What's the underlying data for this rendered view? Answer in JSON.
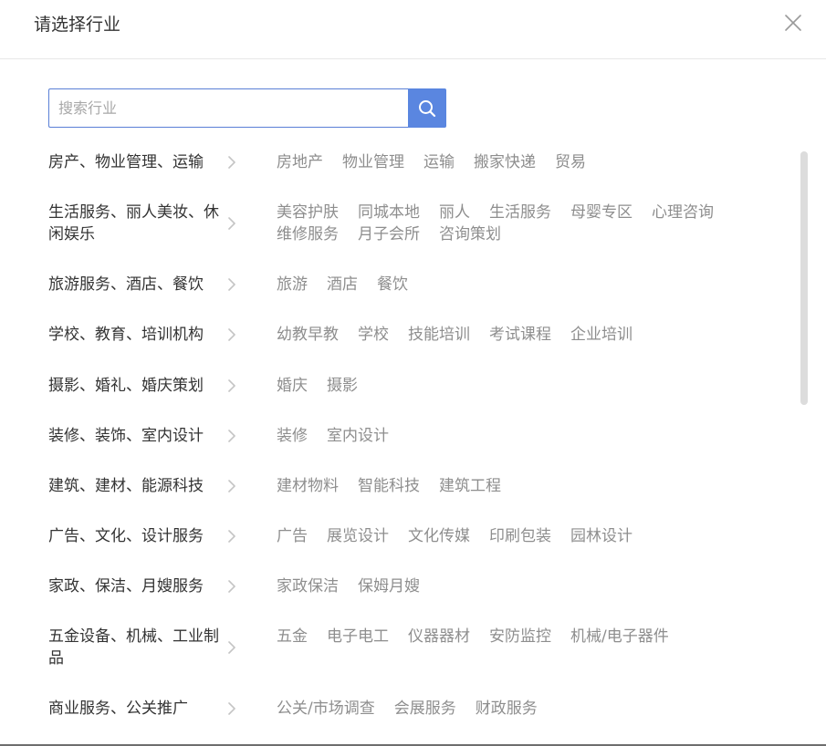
{
  "dialog": {
    "title": "请选择行业",
    "close_icon": "close-icon"
  },
  "search": {
    "placeholder": "搜索行业",
    "value": "",
    "icon": "search-icon",
    "accent_color": "#5a86e0"
  },
  "categories": [
    {
      "label": "房产、物业管理、运输",
      "subs": [
        "房地产",
        "物业管理",
        "运输",
        "搬家快递",
        "贸易"
      ]
    },
    {
      "label": "生活服务、丽人美妆、休闲娱乐",
      "subs": [
        "美容护肤",
        "同城本地",
        "丽人",
        "生活服务",
        "母婴专区",
        "心理咨询",
        "维修服务",
        "月子会所",
        "咨询策划"
      ]
    },
    {
      "label": "旅游服务、酒店、餐饮",
      "subs": [
        "旅游",
        "酒店",
        "餐饮"
      ]
    },
    {
      "label": "学校、教育、培训机构",
      "subs": [
        "幼教早教",
        "学校",
        "技能培训",
        "考试课程",
        "企业培训"
      ]
    },
    {
      "label": "摄影、婚礼、婚庆策划",
      "subs": [
        "婚庆",
        "摄影"
      ]
    },
    {
      "label": "装修、装饰、室内设计",
      "subs": [
        "装修",
        "室内设计"
      ]
    },
    {
      "label": "建筑、建材、能源科技",
      "subs": [
        "建材物料",
        "智能科技",
        "建筑工程"
      ]
    },
    {
      "label": "广告、文化、设计服务",
      "subs": [
        "广告",
        "展览设计",
        "文化传媒",
        "印刷包装",
        "园林设计"
      ]
    },
    {
      "label": "家政、保洁、月嫂服务",
      "subs": [
        "家政保洁",
        "保姆月嫂"
      ]
    },
    {
      "label": "五金设备、机械、工业制品",
      "subs": [
        "五金",
        "电子电工",
        "仪器器材",
        "安防监控",
        "机械/电子器件"
      ]
    },
    {
      "label": "商业服务、公关推广",
      "subs": [
        "公关/市场调查",
        "会展服务",
        "财政服务"
      ]
    }
  ]
}
